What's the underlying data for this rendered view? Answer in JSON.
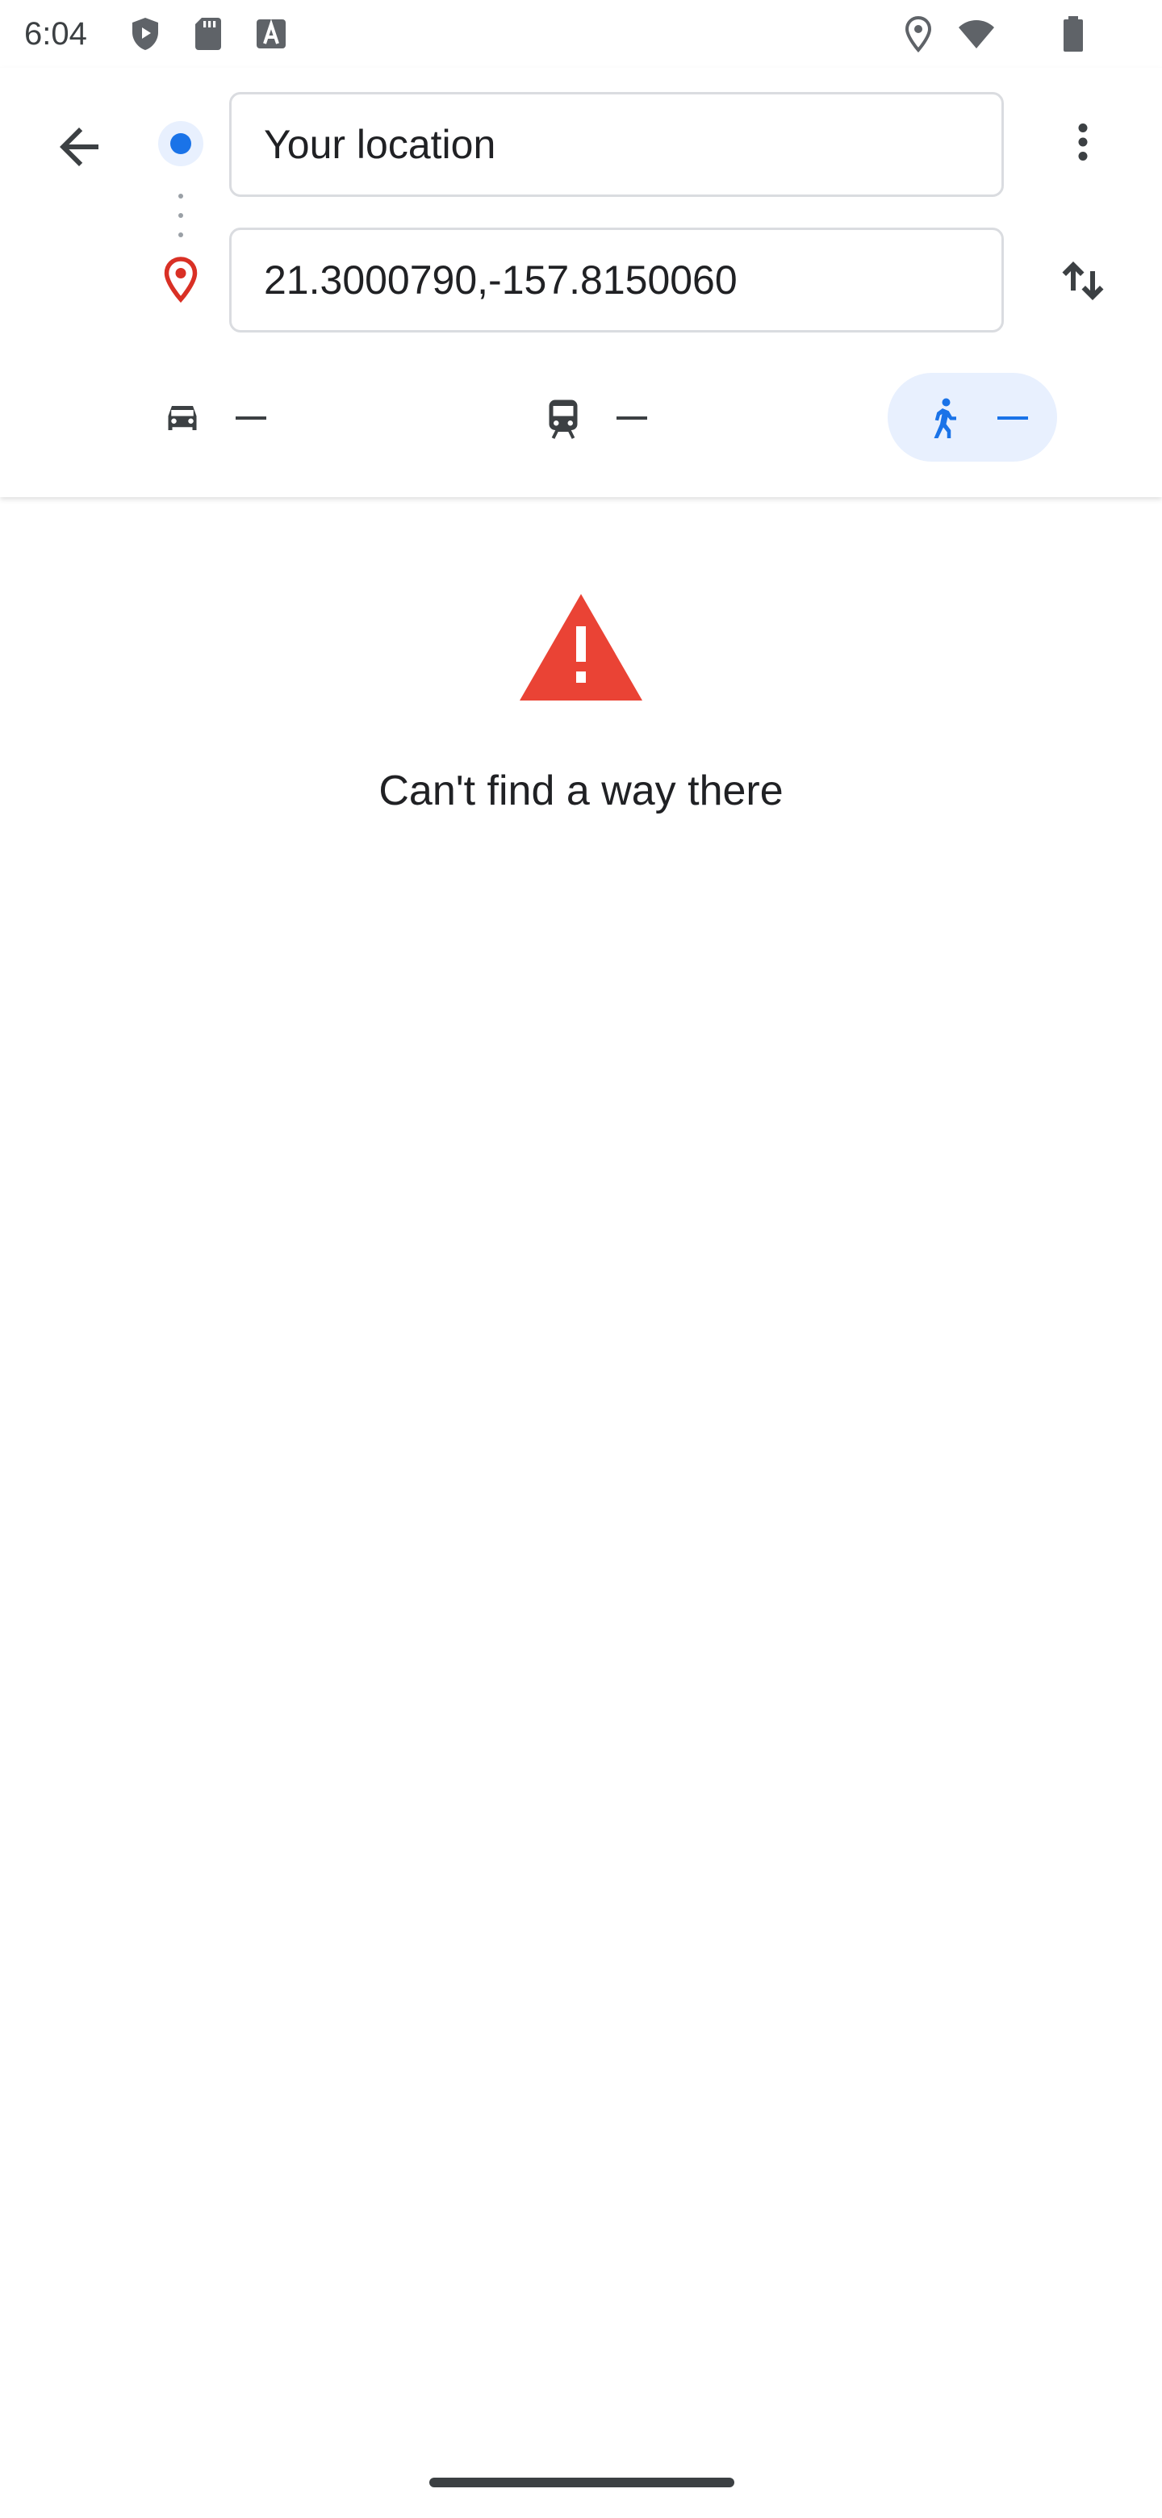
{
  "status_bar": {
    "time": "6:04",
    "left_icons": [
      "play-protect-icon",
      "sd-card-icon",
      "font-a-icon"
    ],
    "right_icons": [
      "location-icon",
      "wifi-icon",
      "battery-icon"
    ]
  },
  "directions": {
    "origin_value": "Your location",
    "destination_value": "21.3000790,-157.8150060",
    "modes": [
      {
        "name": "drive",
        "icon": "car-icon",
        "duration": "—",
        "selected": false
      },
      {
        "name": "transit",
        "icon": "train-icon",
        "duration": "—",
        "selected": false
      },
      {
        "name": "walk",
        "icon": "walking-icon",
        "duration": "—",
        "selected": true
      }
    ]
  },
  "error": {
    "icon": "warning-icon",
    "message": "Can't find a way there"
  },
  "colors": {
    "accent": "#1a73e8",
    "selected_chip": "#e8f0fe",
    "destination_pin": "#d93025",
    "warning": "#ea4335"
  }
}
